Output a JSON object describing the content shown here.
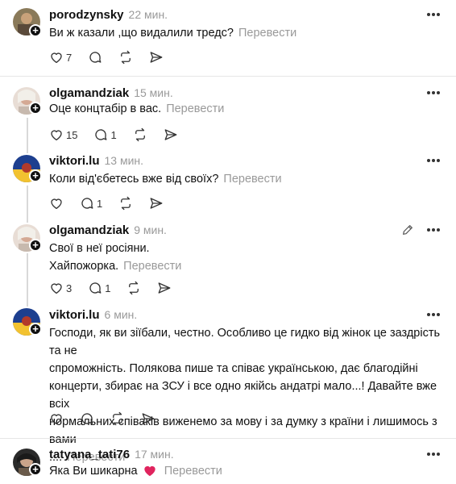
{
  "posts": [
    {
      "username": "porodzynsky",
      "time": "22 мин.",
      "lines": [
        "Ви ж казали ,що видалили тредс?"
      ],
      "translate": "Перевести",
      "likes": "7",
      "replies": ""
    },
    {
      "username": "olgamandziak",
      "time": "15 мин.",
      "lines": [
        "Оце концтабір в вас."
      ],
      "translate": "Перевести",
      "likes": "15",
      "replies": "1"
    },
    {
      "username": "viktori.lu",
      "time": "13 мин.",
      "lines": [
        "Коли від'єбетесь вже від своїх?"
      ],
      "translate": "Перевести",
      "likes": "",
      "replies": "1"
    },
    {
      "username": "olgamandziak",
      "time": "9 мин.",
      "lines": [
        "Свої в неї росіяни.",
        "Хайпожорка."
      ],
      "translate": "Перевести",
      "likes": "3",
      "replies": "1"
    },
    {
      "username": "viktori.lu",
      "time": "6 мин.",
      "lines": [
        "Господи, як ви зіїбали, честно. Особливо це гидко від жінок це заздрість та не",
        "спроможність. Полякова пише та співає українською, дає благодійні",
        "концерти, збирає на ЗСУ і все одно якійсь андатрі мало...! Давайте вже всіх",
        "нормальних співаків виженемо за мову і за думку з країни і лишимось з вами",
        "...."
      ],
      "translate": "Перевести",
      "likes": "",
      "replies": ""
    },
    {
      "username": "tatyana_tati76",
      "time": "17 мин.",
      "lines": [
        "Яка Ви шикарна"
      ],
      "translate": "Перевести",
      "likes": "",
      "replies": ""
    }
  ],
  "icons": {
    "like": "heart-icon",
    "reply": "comment-icon",
    "repost": "repost-icon",
    "share": "share-icon",
    "more": "more-dots-icon",
    "edit": "pencil-icon",
    "follow": "plus-icon",
    "emoji": "red-heart-emoji"
  },
  "colors": {
    "text": "#101010",
    "muted": "#999999",
    "divider": "#e6e6e6",
    "heart_emoji": "#e0245e"
  }
}
